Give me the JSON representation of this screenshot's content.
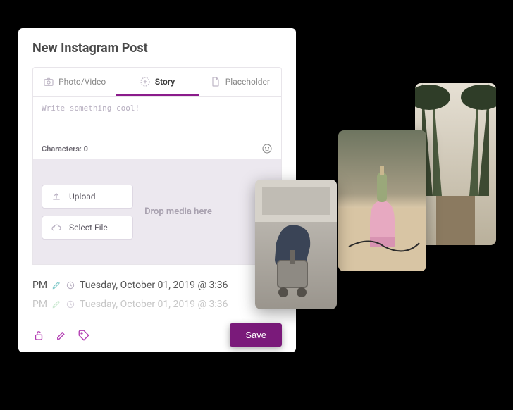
{
  "card": {
    "title": "New Instagram Post"
  },
  "tabs": {
    "photo_video": "Photo/Video",
    "story": "Story",
    "placeholder": "Placeholder"
  },
  "composer": {
    "placeholder": "Write something cool!",
    "char_label": "Characters: 0"
  },
  "media": {
    "upload": "Upload",
    "select_file": "Select File",
    "drop_text": "Drop media here"
  },
  "schedule": {
    "line1_prefix": "PM",
    "line1_text": "Tuesday, October 01, 2019 @ 3:36",
    "line2_prefix": "PM",
    "line2_text": "Tuesday, October 01, 2019 @ 3:36"
  },
  "actions": {
    "save": "Save"
  }
}
